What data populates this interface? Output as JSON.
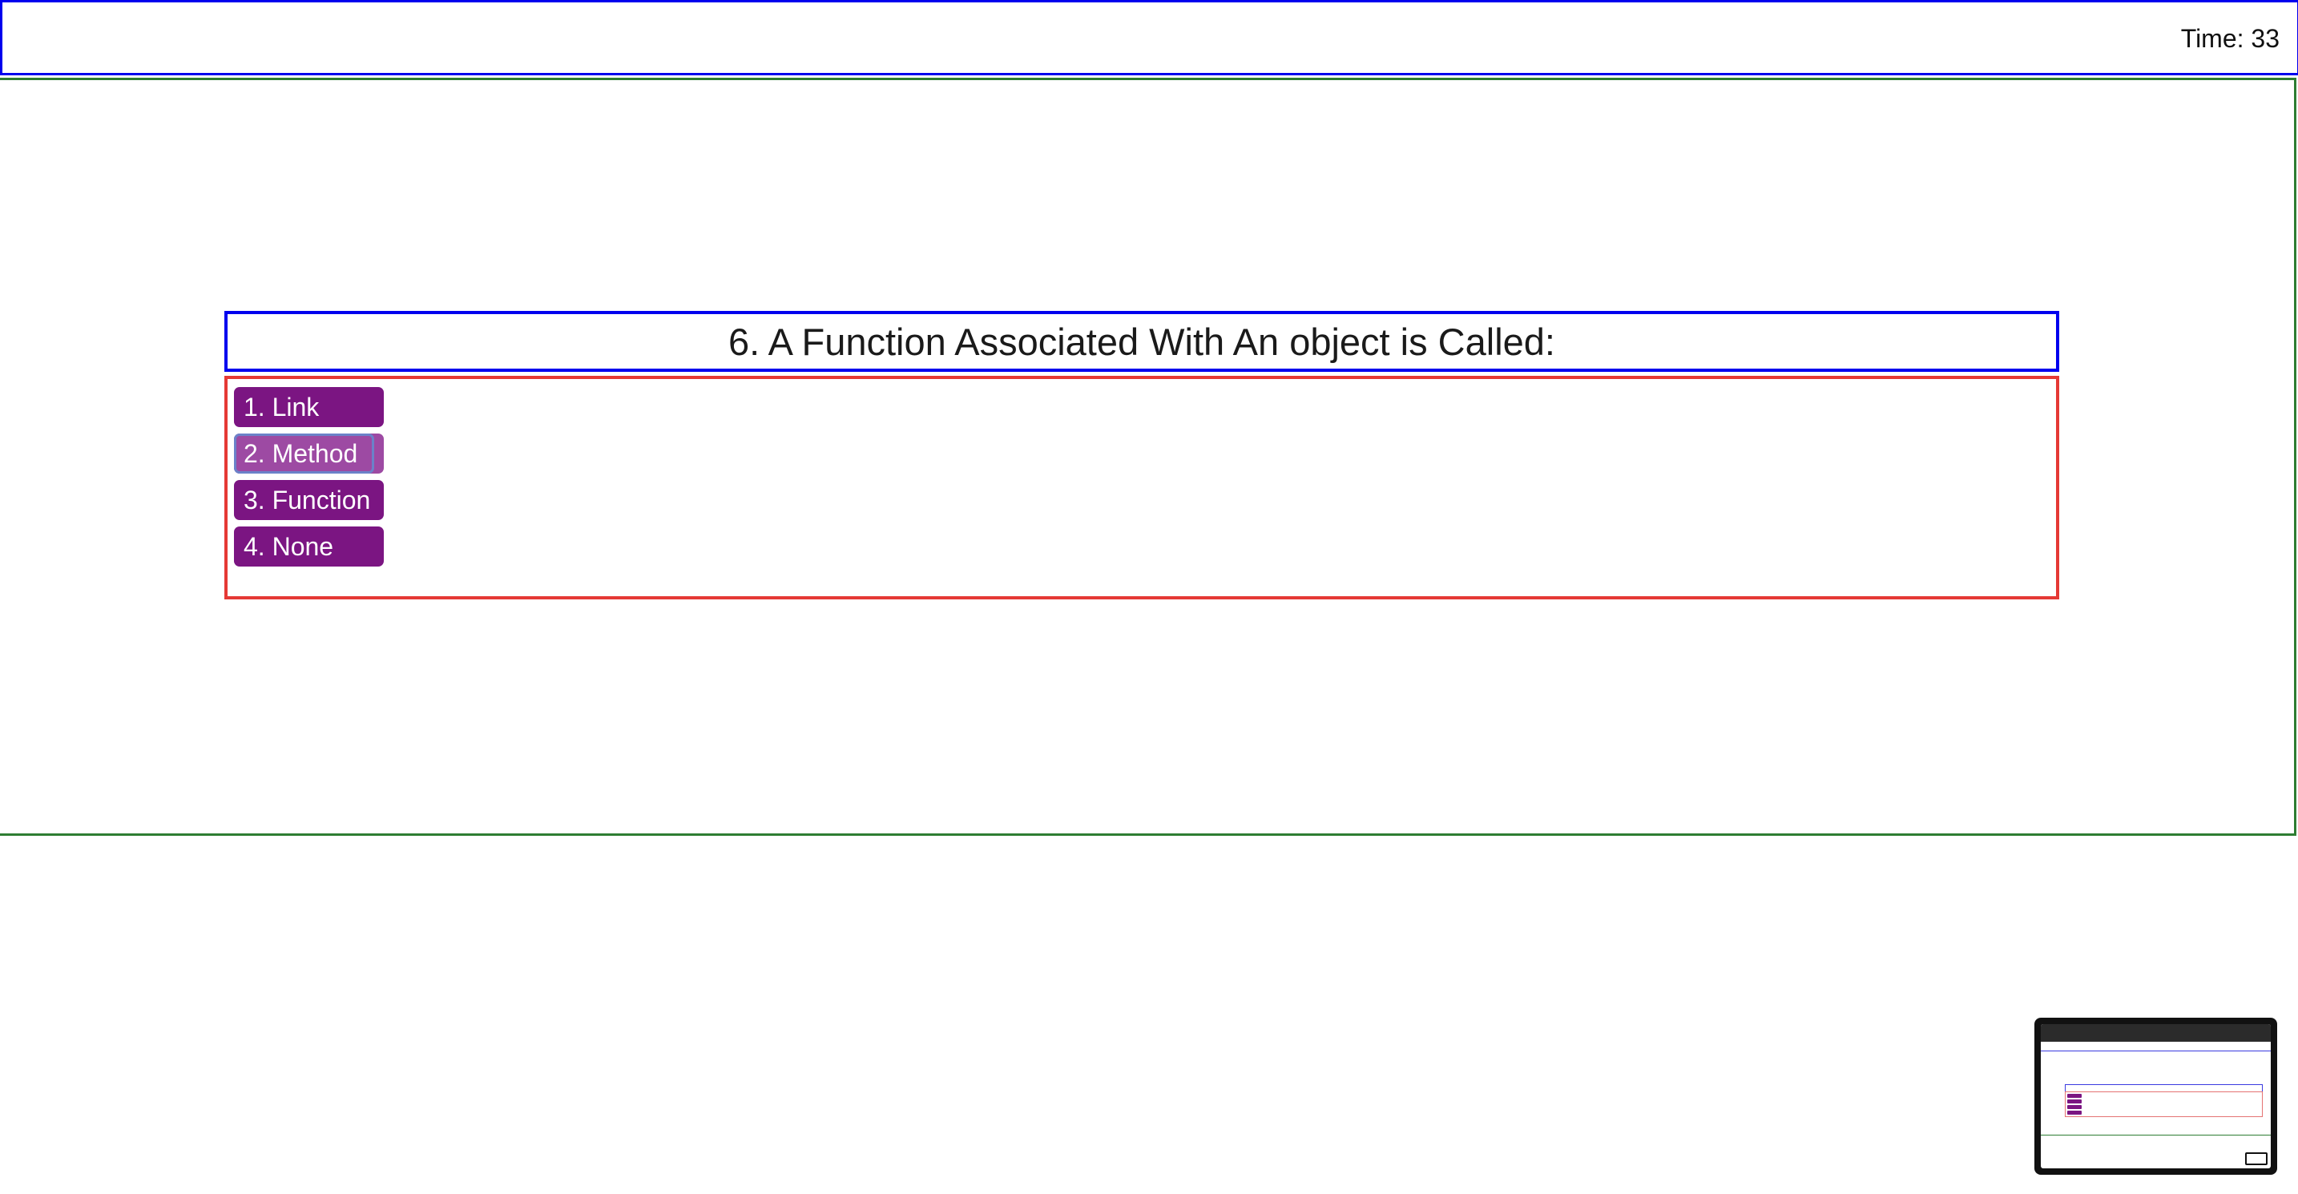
{
  "header": {
    "timer_text": "Time: 33"
  },
  "quiz": {
    "question_text": "6. A Function Associated With An object is Called:",
    "options": [
      {
        "label": "1. Link"
      },
      {
        "label": "2. Method"
      },
      {
        "label": "3. Function"
      },
      {
        "label": "4. None"
      }
    ]
  },
  "colors": {
    "header_border": "#0000ee",
    "main_border": "#2e7d32",
    "question_border": "#0000ee",
    "options_border": "#e53935",
    "option_background": "#7b1582",
    "option_hover_background": "#9d4aa3",
    "option_text": "#ffffff"
  },
  "state": {
    "hovered_option_index": 1
  }
}
